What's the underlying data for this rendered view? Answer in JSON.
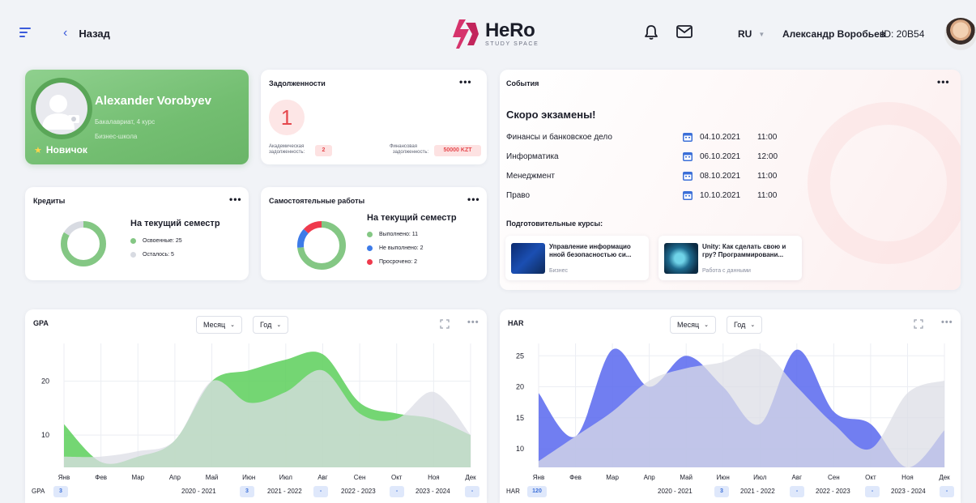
{
  "header": {
    "back_label": "Назад",
    "logo_name": "HeRo",
    "logo_sub": "STUDY SPACE",
    "lang": "RU",
    "user_name": "Александр Воробьев",
    "user_id": "ID: 20B54"
  },
  "profile": {
    "name": "Alexander Vorobyev",
    "degree": "Бакалавриат, 4 курс",
    "school": "Бизнес-школа",
    "rank": "Новичок"
  },
  "debts": {
    "title": "Задолженности",
    "count": "1",
    "academic_label_1": "Академическая",
    "academic_label_2": "задолженность:",
    "academic_value": "2",
    "financial_label_1": "Финансовая",
    "financial_label_2": "задолженность:",
    "financial_value": "50000 KZT"
  },
  "credits": {
    "title": "Кредиты",
    "semester": "На текущий семестр",
    "mastered": "Освоенные: 25",
    "remaining": "Осталось: 5",
    "values": [
      25,
      5
    ],
    "colors": [
      "#84c784",
      "#d8dbe2"
    ]
  },
  "works": {
    "title": "Самостоятельные работы",
    "semester": "На текущий семестр",
    "done": "Выполнено: 11",
    "not_done": "Не выполнено: 2",
    "overdue": "Просрочено: 2",
    "values": [
      11,
      2,
      2
    ],
    "colors": [
      "#84c784",
      "#3d7be8",
      "#ef3a4d"
    ]
  },
  "events": {
    "title": "События",
    "heading": "Скоро экзамены!",
    "exams": [
      {
        "name": "Финансы и банковское дело",
        "date": "04.10.2021",
        "time": "11:00"
      },
      {
        "name": "Информатика",
        "date": "06.10.2021",
        "time": "12:00"
      },
      {
        "name": "Менеджмент",
        "date": "08.10.2021",
        "time": "11:00"
      },
      {
        "name": "Право",
        "date": "10.10.2021",
        "time": "11:00"
      }
    ],
    "prep_heading": "Подготовительные курсы:",
    "courses": [
      {
        "title": "Управление информацио нной безопасностью си...",
        "category": "Бизнес"
      },
      {
        "title": "Unity: Как сделать свою и гру? Программировани...",
        "category": "Работа с данными"
      }
    ]
  },
  "gpa": {
    "title": "GPA",
    "month_label": "Месяц",
    "year_label": "Год",
    "stat_label": "GPA",
    "stat_value": "3",
    "years": [
      {
        "label": "2020 - 2021",
        "value": "3"
      },
      {
        "label": "2021 - 2022",
        "value": "-"
      },
      {
        "label": "2022 - 2023",
        "value": "-"
      },
      {
        "label": "2023 - 2024",
        "value": "-"
      }
    ]
  },
  "har": {
    "title": "HAR",
    "month_label": "Месяц",
    "year_label": "Год",
    "stat_label": "HAR",
    "stat_value": "120",
    "years": [
      {
        "label": "2020 - 2021",
        "value": "3"
      },
      {
        "label": "2021 - 2022",
        "value": "-"
      },
      {
        "label": "2022 - 2023",
        "value": "-"
      },
      {
        "label": "2023 - 2024",
        "value": "-"
      }
    ]
  },
  "colors": {
    "accent": "#3b5bdb",
    "profile_green": "#78c277",
    "danger": "#e5484d",
    "gpa_green": "#5ccf5a",
    "gpa_gray": "#dcdde5",
    "har_blue": "#5867ee",
    "har_gray": "#dcdde5"
  },
  "chart_data": [
    {
      "type": "area",
      "title": "GPA",
      "categories": [
        "Янв",
        "Фев",
        "Мар",
        "Апр",
        "Май",
        "Июн",
        "Июл",
        "Авг",
        "Сен",
        "Окт",
        "Ноя",
        "Дек"
      ],
      "series": [
        {
          "color": "#5ccf5a",
          "values": [
            12,
            5,
            6,
            9,
            20,
            22,
            24,
            25,
            16,
            14,
            13,
            10
          ]
        },
        {
          "color": "#dcdde5",
          "values": [
            6,
            6,
            7,
            9,
            20,
            16,
            18,
            22,
            14,
            13,
            18,
            10
          ]
        }
      ],
      "yticks": [
        10,
        20
      ],
      "ylim": [
        4,
        27
      ],
      "grid": true
    },
    {
      "type": "area",
      "title": "HAR",
      "categories": [
        "Янв",
        "Фев",
        "Мар",
        "Апр",
        "Май",
        "Июн",
        "Июл",
        "Авг",
        "Сен",
        "Окт",
        "Ноя",
        "Дек"
      ],
      "series": [
        {
          "color": "#5867ee",
          "values": [
            19,
            12,
            26,
            20,
            25,
            20,
            14,
            26,
            16,
            14,
            7,
            13
          ]
        },
        {
          "color": "#dcdde5",
          "values": [
            8,
            12,
            16,
            21,
            23,
            24,
            26,
            20,
            14,
            10,
            19,
            21
          ]
        }
      ],
      "yticks": [
        10,
        15,
        20,
        25
      ],
      "ylim": [
        7,
        27
      ],
      "grid": true
    }
  ]
}
